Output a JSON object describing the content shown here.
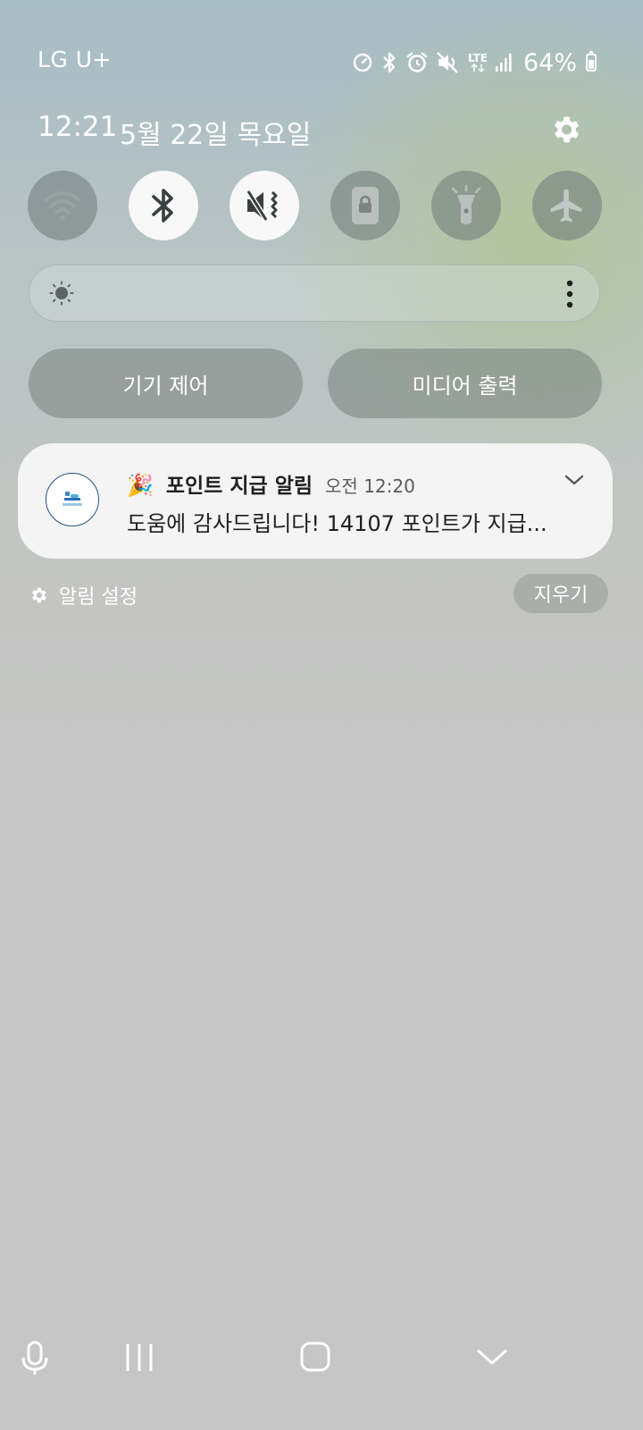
{
  "status_bar": {
    "carrier": "LG U+",
    "network_type": "LTE",
    "battery_percent": "64%",
    "icons": [
      "data-saver-icon",
      "bluetooth-icon",
      "alarm-icon",
      "mute-icon",
      "lte-icon",
      "signal-icon",
      "battery-icon"
    ]
  },
  "header": {
    "time": "12:21",
    "date": "5월 22일 목요일",
    "settings_icon": "gear-icon"
  },
  "quick_toggles": [
    {
      "icon": "wifi-icon",
      "active": false
    },
    {
      "icon": "bluetooth-icon",
      "active": true
    },
    {
      "icon": "mute-vibrate-icon",
      "active": true
    },
    {
      "icon": "screen-lock-icon",
      "active": false
    },
    {
      "icon": "flashlight-icon",
      "active": false
    },
    {
      "icon": "airplane-icon",
      "active": false
    }
  ],
  "brightness": {
    "icon": "sun-icon",
    "more_icon": "more-vertical-icon"
  },
  "buttons": {
    "device_control": "기기 제어",
    "media_output": "미디어 출력"
  },
  "notification": {
    "emoji": "🎉",
    "title": "포인트 지급 알림",
    "time": "오전 12:20",
    "body": "도움에 감사드립니다! 14107 포인트가 지급...",
    "app_icon": "app-logo-icon",
    "expand_icon": "chevron-down-icon"
  },
  "notification_actions": {
    "settings_label": "알림 설정",
    "clear_label": "지우기"
  },
  "nav_bar": [
    "microphone-icon",
    "recents-icon",
    "home-icon",
    "collapse-icon"
  ],
  "colors": {
    "panel_top": "#a8bcc5",
    "background": "#c6c6c6",
    "toggle_on": "#f7f8f7",
    "icon_dark": "#3a3f3f"
  }
}
